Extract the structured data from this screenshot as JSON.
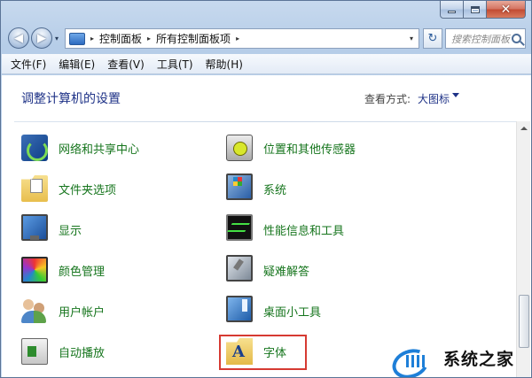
{
  "window": {
    "caption_buttons": {
      "minimize": "minimize",
      "maximize": "maximize",
      "close": "✕"
    },
    "colors": {
      "link_green": "#16751d",
      "heading_blue": "#1e3287",
      "highlight_red": "#d63a32"
    }
  },
  "nav": {
    "back": "◀",
    "forward": "▶",
    "recent": "▾",
    "breadcrumbs": [
      "控制面板",
      "所有控制面板项"
    ],
    "separator": "▸",
    "address_drop": "▾",
    "refresh": "↻",
    "search_placeholder": "搜索控制面板"
  },
  "menubar": {
    "items": [
      "文件(F)",
      "编辑(E)",
      "查看(V)",
      "工具(T)",
      "帮助(H)"
    ]
  },
  "content": {
    "heading": "调整计算机的设置",
    "view_by_label": "查看方式:",
    "view_by_value": "大图标",
    "items": [
      {
        "label": "网络和共享中心",
        "icon": "network-sharing-icon"
      },
      {
        "label": "文件夹选项",
        "icon": "folder-options-icon"
      },
      {
        "label": "显示",
        "icon": "display-monitor-icon"
      },
      {
        "label": "颜色管理",
        "icon": "color-management-icon"
      },
      {
        "label": "用户帐户",
        "icon": "user-accounts-icon"
      },
      {
        "label": "自动播放",
        "icon": "autoplay-icon"
      },
      {
        "label": "位置和其他传感器",
        "icon": "location-sensor-icon"
      },
      {
        "label": "系统",
        "icon": "system-icon"
      },
      {
        "label": "性能信息和工具",
        "icon": "performance-icon"
      },
      {
        "label": "疑难解答",
        "icon": "troubleshooting-icon"
      },
      {
        "label": "桌面小工具",
        "icon": "desktop-gadgets-icon"
      },
      {
        "label": "字体",
        "icon": "fonts-folder-icon"
      }
    ]
  },
  "watermark": {
    "text": "系统之家"
  }
}
